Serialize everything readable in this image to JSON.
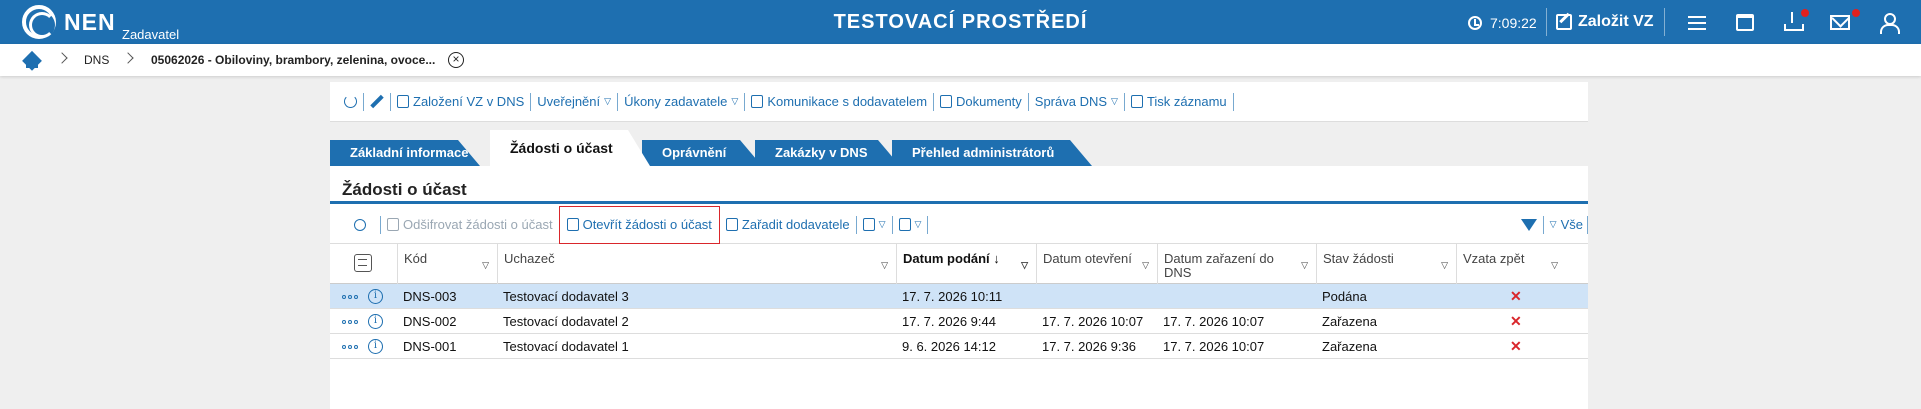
{
  "header": {
    "brand": "NEN",
    "role": "Zadavatel",
    "environment": "TESTOVACÍ PROSTŘEDÍ",
    "clock": "7:09:22",
    "new_vz_label": "Založit VZ",
    "accent_color": "#1e6fb0"
  },
  "breadcrumb": {
    "items": [
      "DNS",
      "05062026 - Obiloviny, brambory, zelenina, ovoce..."
    ]
  },
  "actions": [
    "Založení VZ v DNS",
    "Uveřejnění",
    "Úkony zadavatele",
    "Komunikace s dodavatelem",
    "Dokumenty",
    "Správa DNS",
    "Tisk záznamu"
  ],
  "tabs": [
    "Základní informace",
    "Žádosti o účast",
    "Oprávnění",
    "Zakázky v DNS",
    "Přehled administrátorů"
  ],
  "section_title": "Žádosti o účast",
  "grid_actions": {
    "decrypt": "Odšifrovat žádosti o účast",
    "open": "Otevřít žádosti o účast",
    "assign": "Zařadit dodavatele",
    "filter_all": "Vše"
  },
  "columns": [
    "Kód",
    "Uchazeč",
    "Datum podání",
    "Datum otevření",
    "Datum zařazení do DNS",
    "Stav žádosti",
    "Vzata zpět"
  ],
  "rows": [
    {
      "code": "DNS-003",
      "bidder": "Testovací dodavatel 3",
      "submitted": "17. 7. 2026 10:11",
      "opened": "",
      "assigned": "",
      "status": "Podána",
      "withdrawn": "✕"
    },
    {
      "code": "DNS-002",
      "bidder": "Testovací dodavatel 2",
      "submitted": "17. 7. 2026 9:44",
      "opened": "17. 7. 2026 10:07",
      "assigned": "17. 7. 2026 10:07",
      "status": "Zařazena",
      "withdrawn": "✕"
    },
    {
      "code": "DNS-001",
      "bidder": "Testovací dodavatel 1",
      "submitted": "9. 6. 2026 14:12",
      "opened": "17. 7. 2026 9:36",
      "assigned": "17. 7. 2026 10:07",
      "status": "Zařazena",
      "withdrawn": "✕"
    }
  ]
}
